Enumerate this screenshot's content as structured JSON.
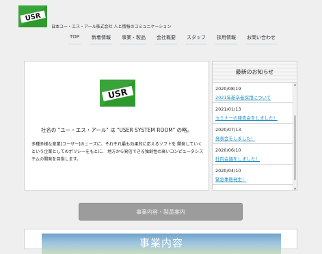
{
  "header": {
    "logo_text": "USR",
    "tagline": "日本ユー・エス・アール株式会社 人と情報のコミュニケーション"
  },
  "nav": [
    {
      "label": "TOP"
    },
    {
      "label": "新着情報"
    },
    {
      "label": "事業・製品"
    },
    {
      "label": "会社概要"
    },
    {
      "label": "スタッフ"
    },
    {
      "label": "採用情報"
    },
    {
      "label": "お問い合わせ"
    }
  ],
  "main": {
    "logo_text": "USR",
    "company_desc": "社名の \"ユー・エス・アール\" は \"USER SYSTEM ROOM\" の略。",
    "policy": "多種多様な産業[ユーザー]のニーズに、それぞれ最も効果的に応えるソフトを 開発していくという企業としてのポリシーをもとに、 地方から発信できる独創性の高いコンピュータシステムの開発を目指します。"
  },
  "news": {
    "title": "最新のお知らせ",
    "items": [
      {
        "date": "2020/08/19",
        "text": "2021年新卒者採用について"
      },
      {
        "date": "2021/01/13",
        "text": "セミナーの報告会をしました！"
      },
      {
        "date": "2020/07/13",
        "text": "発表会をしました！"
      },
      {
        "date": "2020/06/10",
        "text": "社内会議をしました！"
      },
      {
        "date": "2020/04/10",
        "text": "緊急事態発生！"
      }
    ]
  },
  "business_button": {
    "label": "事業内容・製品案内"
  },
  "banner": {
    "title": "事業内容"
  },
  "colors": {
    "brand_green": "#2e9a2e",
    "link": "#1b8fc0",
    "button": "#9c9c9c"
  }
}
